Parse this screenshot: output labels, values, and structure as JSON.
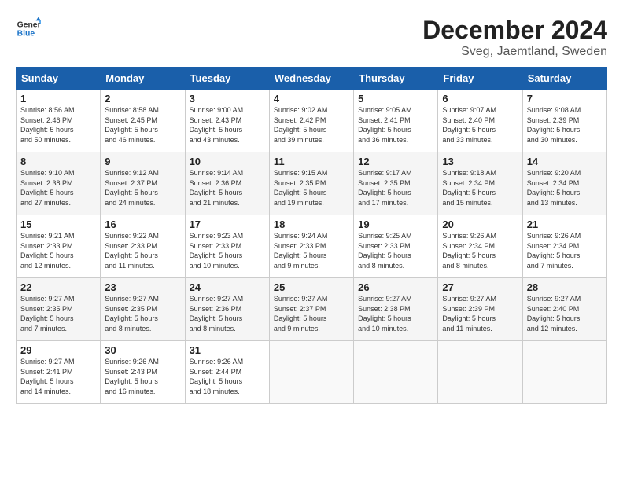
{
  "logo": {
    "line1": "General",
    "line2": "Blue"
  },
  "title": "December 2024",
  "subtitle": "Sveg, Jaemtland, Sweden",
  "days_header": [
    "Sunday",
    "Monday",
    "Tuesday",
    "Wednesday",
    "Thursday",
    "Friday",
    "Saturday"
  ],
  "weeks": [
    [
      {
        "day": "1",
        "info": "Sunrise: 8:56 AM\nSunset: 2:46 PM\nDaylight: 5 hours\nand 50 minutes."
      },
      {
        "day": "2",
        "info": "Sunrise: 8:58 AM\nSunset: 2:45 PM\nDaylight: 5 hours\nand 46 minutes."
      },
      {
        "day": "3",
        "info": "Sunrise: 9:00 AM\nSunset: 2:43 PM\nDaylight: 5 hours\nand 43 minutes."
      },
      {
        "day": "4",
        "info": "Sunrise: 9:02 AM\nSunset: 2:42 PM\nDaylight: 5 hours\nand 39 minutes."
      },
      {
        "day": "5",
        "info": "Sunrise: 9:05 AM\nSunset: 2:41 PM\nDaylight: 5 hours\nand 36 minutes."
      },
      {
        "day": "6",
        "info": "Sunrise: 9:07 AM\nSunset: 2:40 PM\nDaylight: 5 hours\nand 33 minutes."
      },
      {
        "day": "7",
        "info": "Sunrise: 9:08 AM\nSunset: 2:39 PM\nDaylight: 5 hours\nand 30 minutes."
      }
    ],
    [
      {
        "day": "8",
        "info": "Sunrise: 9:10 AM\nSunset: 2:38 PM\nDaylight: 5 hours\nand 27 minutes."
      },
      {
        "day": "9",
        "info": "Sunrise: 9:12 AM\nSunset: 2:37 PM\nDaylight: 5 hours\nand 24 minutes."
      },
      {
        "day": "10",
        "info": "Sunrise: 9:14 AM\nSunset: 2:36 PM\nDaylight: 5 hours\nand 21 minutes."
      },
      {
        "day": "11",
        "info": "Sunrise: 9:15 AM\nSunset: 2:35 PM\nDaylight: 5 hours\nand 19 minutes."
      },
      {
        "day": "12",
        "info": "Sunrise: 9:17 AM\nSunset: 2:35 PM\nDaylight: 5 hours\nand 17 minutes."
      },
      {
        "day": "13",
        "info": "Sunrise: 9:18 AM\nSunset: 2:34 PM\nDaylight: 5 hours\nand 15 minutes."
      },
      {
        "day": "14",
        "info": "Sunrise: 9:20 AM\nSunset: 2:34 PM\nDaylight: 5 hours\nand 13 minutes."
      }
    ],
    [
      {
        "day": "15",
        "info": "Sunrise: 9:21 AM\nSunset: 2:33 PM\nDaylight: 5 hours\nand 12 minutes."
      },
      {
        "day": "16",
        "info": "Sunrise: 9:22 AM\nSunset: 2:33 PM\nDaylight: 5 hours\nand 11 minutes."
      },
      {
        "day": "17",
        "info": "Sunrise: 9:23 AM\nSunset: 2:33 PM\nDaylight: 5 hours\nand 10 minutes."
      },
      {
        "day": "18",
        "info": "Sunrise: 9:24 AM\nSunset: 2:33 PM\nDaylight: 5 hours\nand 9 minutes."
      },
      {
        "day": "19",
        "info": "Sunrise: 9:25 AM\nSunset: 2:33 PM\nDaylight: 5 hours\nand 8 minutes."
      },
      {
        "day": "20",
        "info": "Sunrise: 9:26 AM\nSunset: 2:34 PM\nDaylight: 5 hours\nand 8 minutes."
      },
      {
        "day": "21",
        "info": "Sunrise: 9:26 AM\nSunset: 2:34 PM\nDaylight: 5 hours\nand 7 minutes."
      }
    ],
    [
      {
        "day": "22",
        "info": "Sunrise: 9:27 AM\nSunset: 2:35 PM\nDaylight: 5 hours\nand 7 minutes."
      },
      {
        "day": "23",
        "info": "Sunrise: 9:27 AM\nSunset: 2:35 PM\nDaylight: 5 hours\nand 8 minutes."
      },
      {
        "day": "24",
        "info": "Sunrise: 9:27 AM\nSunset: 2:36 PM\nDaylight: 5 hours\nand 8 minutes."
      },
      {
        "day": "25",
        "info": "Sunrise: 9:27 AM\nSunset: 2:37 PM\nDaylight: 5 hours\nand 9 minutes."
      },
      {
        "day": "26",
        "info": "Sunrise: 9:27 AM\nSunset: 2:38 PM\nDaylight: 5 hours\nand 10 minutes."
      },
      {
        "day": "27",
        "info": "Sunrise: 9:27 AM\nSunset: 2:39 PM\nDaylight: 5 hours\nand 11 minutes."
      },
      {
        "day": "28",
        "info": "Sunrise: 9:27 AM\nSunset: 2:40 PM\nDaylight: 5 hours\nand 12 minutes."
      }
    ],
    [
      {
        "day": "29",
        "info": "Sunrise: 9:27 AM\nSunset: 2:41 PM\nDaylight: 5 hours\nand 14 minutes."
      },
      {
        "day": "30",
        "info": "Sunrise: 9:26 AM\nSunset: 2:43 PM\nDaylight: 5 hours\nand 16 minutes."
      },
      {
        "day": "31",
        "info": "Sunrise: 9:26 AM\nSunset: 2:44 PM\nDaylight: 5 hours\nand 18 minutes."
      },
      {
        "day": "",
        "info": ""
      },
      {
        "day": "",
        "info": ""
      },
      {
        "day": "",
        "info": ""
      },
      {
        "day": "",
        "info": ""
      }
    ]
  ]
}
